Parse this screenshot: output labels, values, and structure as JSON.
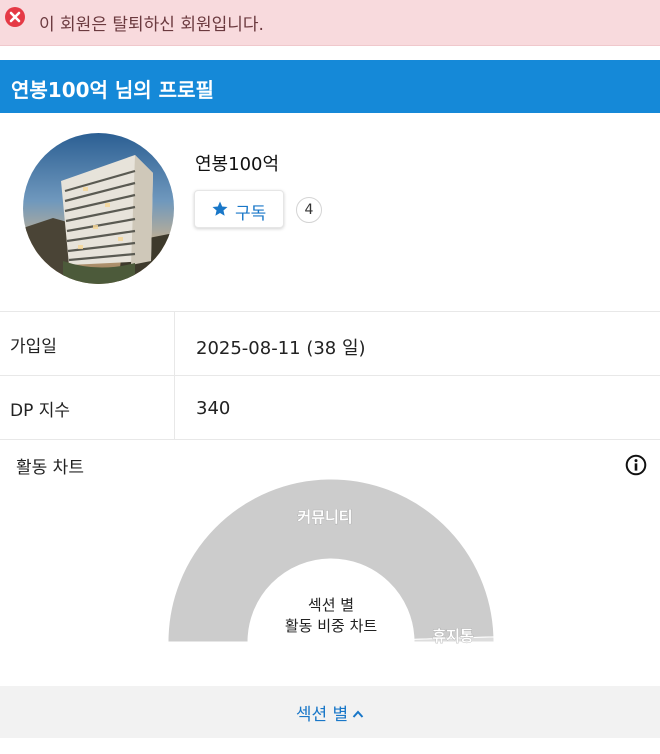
{
  "alert": {
    "icon": "error-circle-icon",
    "message": "이 회원은 탈퇴하신 회원입니다.",
    "color": "#e53945"
  },
  "profile": {
    "header_title": "연봉100억 님의 프로필",
    "header_color": "#1589d8",
    "avatar": "building-photo",
    "username": "연봉100억",
    "subscribe_label": "구독",
    "subscribe_icon": "star-icon",
    "subscriber_count": "4"
  },
  "info": {
    "rows": [
      {
        "label": "가입일",
        "value": "2025-08-11 (38 일)"
      },
      {
        "label": "DP 지수",
        "value": "340"
      }
    ]
  },
  "activity_chart": {
    "title": "활동 차트",
    "info_icon": "info-icon",
    "center_label_line1": "섹션 별",
    "center_label_line2": "활동 비중 차트"
  },
  "footer": {
    "label": "섹션 별",
    "icon": "caret-up-icon"
  },
  "chart_data": {
    "type": "pie",
    "style": "half-donut",
    "title": "섹션 별 활동 비중 차트",
    "series": [
      {
        "label": "커뮤니티",
        "value": 99,
        "color": "#cccccc"
      },
      {
        "label": "휴지통",
        "value": 1,
        "color": "#dddddd"
      }
    ]
  }
}
